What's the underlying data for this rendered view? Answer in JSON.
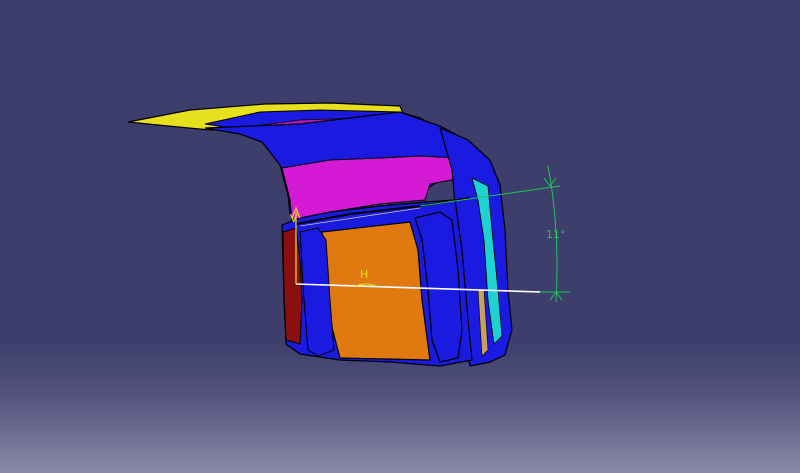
{
  "viewer": {
    "background_top": "#3d3d6b",
    "background_bottom": "#8a8aa8"
  },
  "annotations": {
    "angle_dimension": "11°",
    "horizontal_marker": "H",
    "vertical_marker": "V",
    "dimension_color": "#22c45a",
    "marker_color": "#e8e020"
  },
  "part": {
    "surface_colors": {
      "top_flange": "#e6e01e",
      "main_shell": "#1a1ae0",
      "magenta_face": "#d41ad4",
      "orange_face": "#e07a10",
      "cyan_strip": "#1ed2d2",
      "dark_red": "#8a1010",
      "edge": "#000000"
    }
  }
}
